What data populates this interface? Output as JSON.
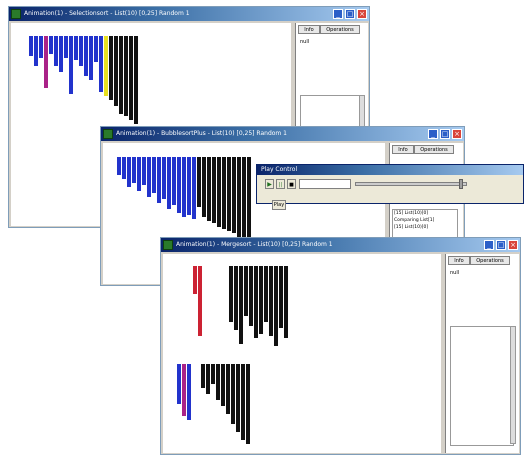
{
  "windows": [
    {
      "title": "Animation(1) - Selectionsort - List(10) [0,25] Random 1",
      "tabs": [
        "Info",
        "Operations"
      ],
      "info_text": "null"
    },
    {
      "title": "Animation(1) - BubblesortPlus - List(10) [0,25] Random 1",
      "tabs": [
        "Info",
        "Operations"
      ],
      "log_lines": [
        "[15] List(10)[0]",
        "Comparing List[1]",
        "[15] List(10)[0]"
      ]
    },
    {
      "title": "Animation(1) - Mergesort - List(10) [0,25] Random 1",
      "tabs": [
        "Info",
        "Operations"
      ],
      "info_text": "null"
    }
  ],
  "play_control": {
    "title": "Play Control",
    "buttons": [
      "▶",
      "||",
      "■"
    ],
    "play_label": "Play"
  },
  "colors": {
    "default_bar": "#2233cc",
    "sorted_bar": "#111111",
    "highlight_red": "#cc2233",
    "highlight_yellow": "#e8e020",
    "highlight_magenta": "#aa2288"
  }
}
